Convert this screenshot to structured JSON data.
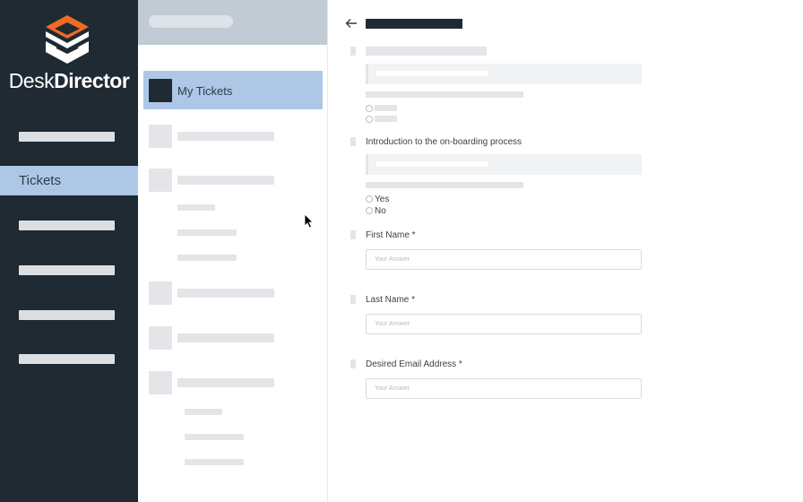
{
  "sidebar": {
    "brand_light": "Desk",
    "brand_bold": "Director",
    "active_item": "Tickets",
    "colors": {
      "background": "#1f2a33",
      "active": "#aec7e6",
      "logo_orange": "#f26a25"
    }
  },
  "panel": {
    "active_item": "My Tickets"
  },
  "form": {
    "questions": {
      "onboarding": {
        "label": "Introduction to the on-boarding process",
        "options": [
          "Yes",
          "No"
        ]
      },
      "first_name": {
        "label": "First Name *",
        "placeholder": "Your Answer"
      },
      "last_name": {
        "label": "Last Name *",
        "placeholder": "Your Answer"
      },
      "email": {
        "label": "Desired Email Address *",
        "placeholder": "Your Answer"
      }
    }
  }
}
